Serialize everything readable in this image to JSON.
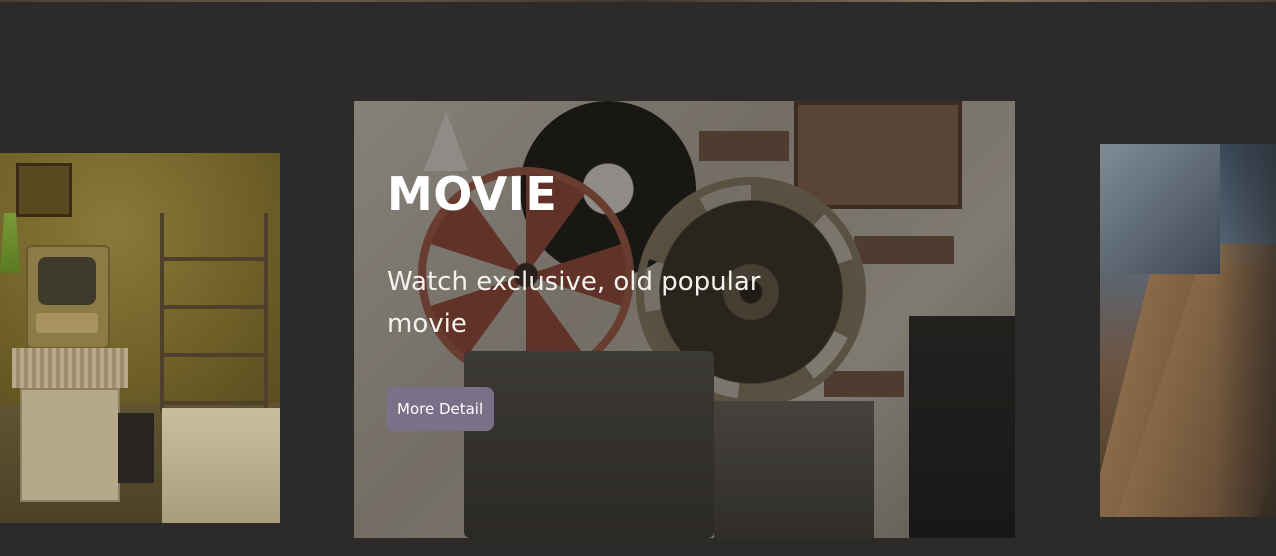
{
  "carousel": {
    "slides": [
      {
        "image": "vintage-room-photo"
      },
      {
        "image": "film-reels-projector-photo",
        "title": "MOVIE",
        "description": "Watch exclusive, old popular movie",
        "button_label": "More Detail"
      },
      {
        "image": "vinyl-records-crate-photo"
      }
    ]
  },
  "colors": {
    "background": "#2d2b29",
    "button_background": "#7a7188",
    "text": "#ffffff"
  }
}
